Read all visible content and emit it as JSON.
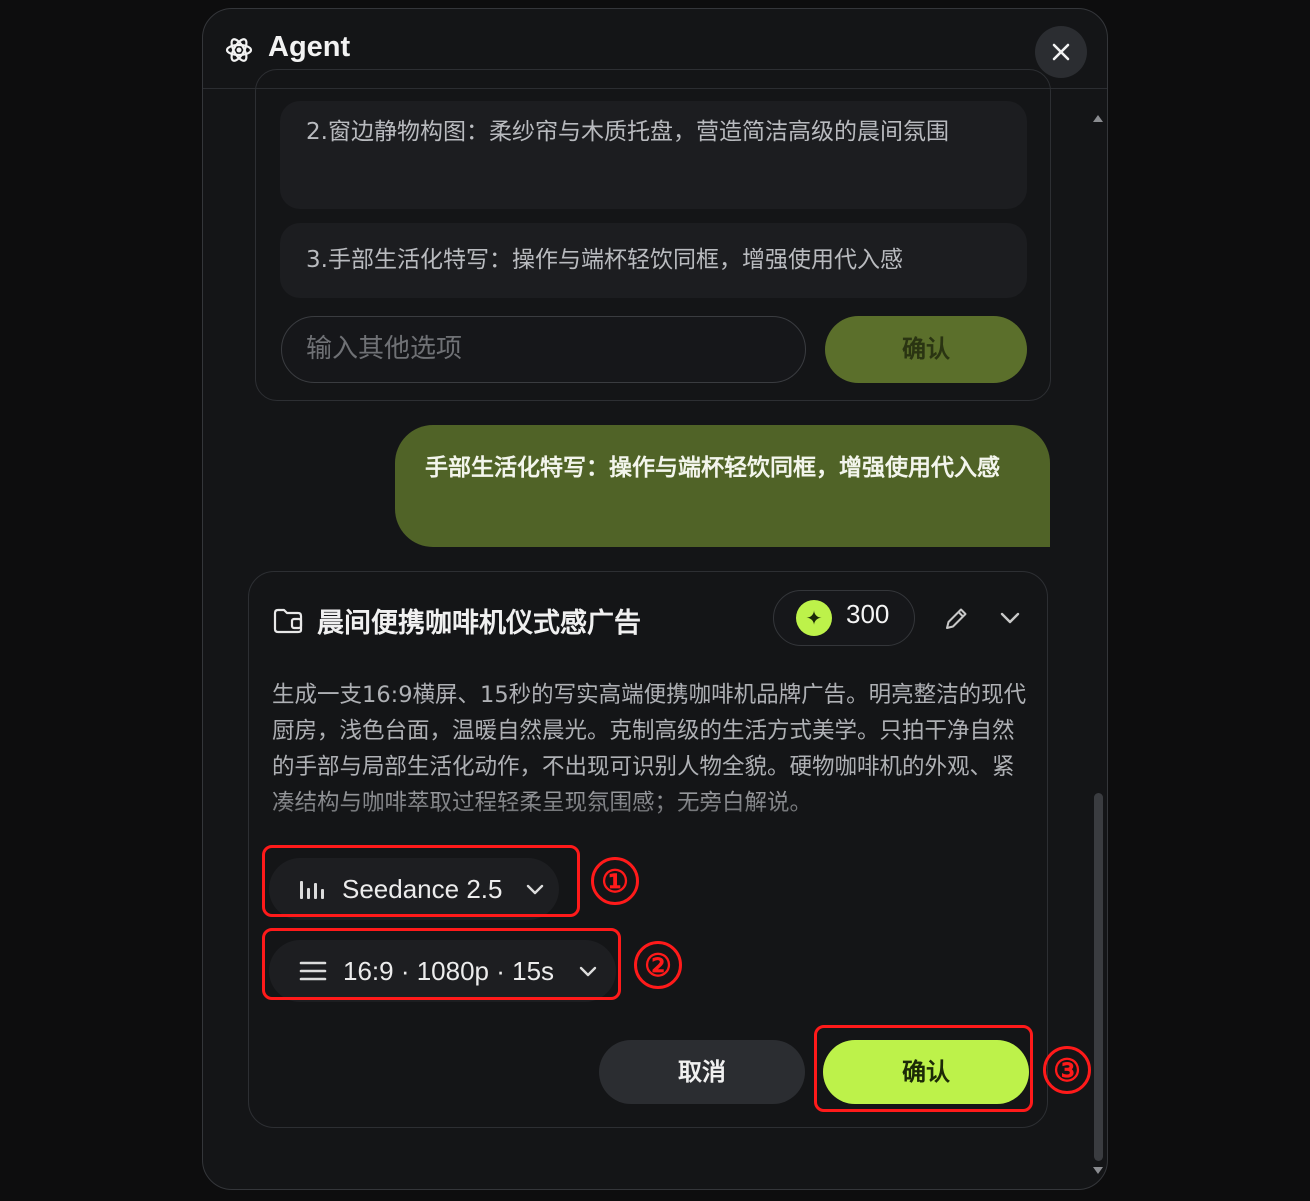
{
  "header": {
    "title": "Agent",
    "close_icon": "close-icon",
    "agent_icon": "atom-icon"
  },
  "options": {
    "items": [
      "2.窗边静物构图：柔纱帘与木质托盘，营造简洁高级的晨间氛围",
      "3.手部生活化特写：操作与端杯轻饮同框，增强使用代入感"
    ],
    "input_placeholder": "输入其他选项",
    "confirm_label": "确认"
  },
  "user_message": "手部生活化特写：操作与端杯轻饮同框，增强使用代入感",
  "task": {
    "title": "晨间便携咖啡机仪式感广告",
    "credits": "300",
    "description": "生成一支16:9横屏、15秒的写实高端便携咖啡机品牌广告。明亮整洁的现代厨房，浅色台面，温暖自然晨光。克制高级的生活方式美学。只拍干净自然的手部与局部生活化动作，不出现可识别人物全貌。硬物咖啡机的外观、紧凑结构与咖啡萃取过程轻柔呈现氛围感；无旁白解说。",
    "model_label": "Seedance 2.5",
    "settings_label": "16:9 · 1080p · 15s",
    "cancel_label": "取消",
    "confirm_label": "确认"
  },
  "annotations": {
    "one": "①",
    "two": "②",
    "three": "③",
    "color": "#ff1a1a"
  },
  "colors": {
    "accent": "#bdf24a",
    "user_bubble": "#506327",
    "background": "#141517"
  }
}
